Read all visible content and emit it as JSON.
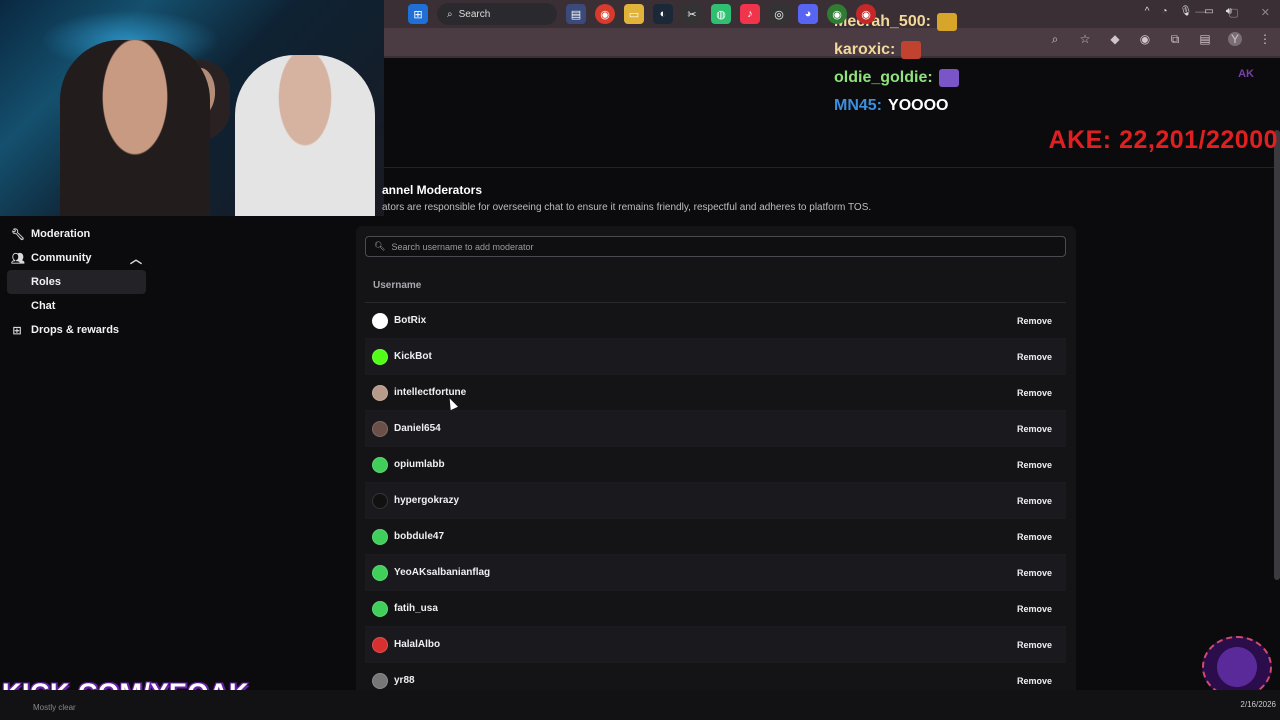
{
  "chat": {
    "lines": [
      {
        "user": "Meerah_500:",
        "msg": "",
        "emote": "#d6a52a"
      },
      {
        "user": "karoxic:",
        "msg": "",
        "emote": "#c0432f"
      },
      {
        "user": "oldie_goldie:",
        "msg": "",
        "emote": "#7a55c8"
      },
      {
        "user": "MN45:",
        "msg": "YOOOO",
        "emote": ""
      }
    ],
    "user_colors": [
      "#f3d89a",
      "#f3d89a",
      "#8fe27c",
      "#3a8fe0"
    ]
  },
  "goal": "AKE: 22,201/22000",
  "sidebar": {
    "moderation": "Moderation",
    "community": "Community",
    "roles": "Roles",
    "chat": "Chat",
    "drops": "Drops & rewards"
  },
  "main": {
    "heading": "annel Moderators",
    "description": "ators are responsible for overseeing chat to ensure it remains friendly, respectful and adheres to platform TOS.",
    "search_placeholder": "Search username to add moderator",
    "column_header": "Username",
    "remove_label": "Remove",
    "moderators": [
      {
        "name": "BotRix",
        "color": "#ffffff"
      },
      {
        "name": "KickBot",
        "color": "#53fc18"
      },
      {
        "name": "intellectfortune",
        "color": "#b89a8a"
      },
      {
        "name": "Daniel654",
        "color": "#6a5048"
      },
      {
        "name": "opiumlabb",
        "color": "#3fcf5a"
      },
      {
        "name": "hypergokrazy",
        "color": "#111111"
      },
      {
        "name": "bobdule47",
        "color": "#3fcf5a"
      },
      {
        "name": "YeoAKsalbanianflag",
        "color": "#3fcf5a"
      },
      {
        "name": "fatih_usa",
        "color": "#3fcf5a"
      },
      {
        "name": "HalalAlbo",
        "color": "#d83030"
      },
      {
        "name": "yr88",
        "color": "#777777"
      }
    ]
  },
  "overlay": {
    "brand": "KICK.COM/YEOAK",
    "weather": "Mostly clear"
  },
  "taskbar": {
    "search": "Search",
    "date": "2/16/2026"
  }
}
